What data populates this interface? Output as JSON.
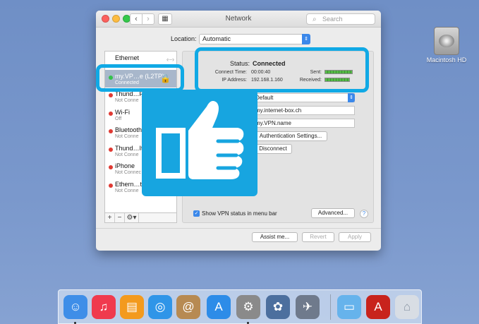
{
  "desktop": {
    "drive_label": "Macintosh HD"
  },
  "window": {
    "title": "Network",
    "search_placeholder": "Search",
    "location_label": "Location:",
    "location_value": "Automatic"
  },
  "sidebar": {
    "items": [
      {
        "name": "Ethernet",
        "status": "",
        "dot": ""
      },
      {
        "name": "my.VP…e (L2TP)",
        "status": "Connected",
        "dot": "#33c24a"
      },
      {
        "name": "Thund…F",
        "status": "Not Conne",
        "dot": "#e03a33"
      },
      {
        "name": "Wi-Fi",
        "status": "Off",
        "dot": "#e03a33"
      },
      {
        "name": "Bluetooth",
        "status": "Not Conne",
        "dot": "#e03a33"
      },
      {
        "name": "Thund…It",
        "status": "Not Conne",
        "dot": "#e03a33"
      },
      {
        "name": "iPhone",
        "status": "Not Connec",
        "dot": "#e03a33"
      },
      {
        "name": "Ethern…t",
        "status": "Not Conne",
        "dot": "#e03a33"
      }
    ],
    "footer": {
      "add": "+",
      "remove": "−",
      "gear": "⚙▾"
    }
  },
  "status": {
    "label": "Status:",
    "value": "Connected",
    "connect_time_label": "Connect Time:",
    "connect_time": "00:00:40",
    "ip_label": "IP Address:",
    "ip": "192.168.1.160",
    "sent_label": "Sent:",
    "received_label": "Received:",
    "sent_level": 1.0,
    "received_level": 0.9
  },
  "config": {
    "configuration_value": "Default",
    "server_address": "my.internet-box.ch",
    "account_name": "my.VPN.name",
    "auth_button": "Authentication Settings...",
    "disconnect_button": "Disconnect"
  },
  "footer": {
    "show_vpn_label": "Show VPN status in menu bar",
    "advanced_button": "Advanced...",
    "help": "?",
    "assist_button": "Assist me...",
    "revert_button": "Revert",
    "apply_button": "Apply"
  },
  "dock": {
    "apps": [
      {
        "name": "finder-icon",
        "glyph": "☺",
        "color": "#3e8ee8"
      },
      {
        "name": "itunes-icon",
        "glyph": "♫",
        "color": "#f03a4e"
      },
      {
        "name": "ibooks-icon",
        "glyph": "▤",
        "color": "#f39a1e"
      },
      {
        "name": "safari-icon",
        "glyph": "◎",
        "color": "#2f95e8"
      },
      {
        "name": "contacts-icon",
        "glyph": "@",
        "color": "#b78a52"
      },
      {
        "name": "app-store-icon",
        "glyph": "A",
        "color": "#2d8ce8"
      },
      {
        "name": "system-preferences-icon",
        "glyph": "⚙",
        "color": "#8a8a8a"
      },
      {
        "name": "iphoto-icon",
        "glyph": "✿",
        "color": "#4c6f9e"
      },
      {
        "name": "launchpad-icon",
        "glyph": "✈",
        "color": "#6f7a8c"
      },
      {
        "name": "folder-icon",
        "glyph": "▭",
        "color": "#66b3ec"
      },
      {
        "name": "acrobat-icon",
        "glyph": "A",
        "color": "#c8231c"
      },
      {
        "name": "trash-icon",
        "glyph": "⌂",
        "color": "#d8dde4"
      }
    ]
  }
}
